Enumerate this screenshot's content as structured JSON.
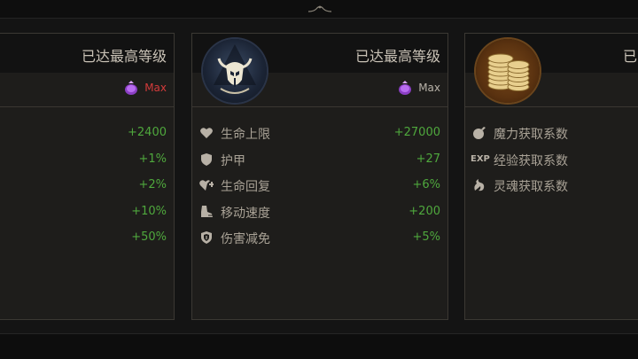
{
  "cards": [
    {
      "title": "已达最高等级",
      "level": "Max",
      "level_color": "#d33b3b",
      "stats": [
        {
          "value": "+2400"
        },
        {
          "value": "+1%"
        },
        {
          "value": "+2%"
        },
        {
          "value": "+10%"
        },
        {
          "value": "+50%"
        }
      ]
    },
    {
      "title": "已达最高等级",
      "level": "Max",
      "level_color": "#b8b2a8",
      "emblem_icon": "horned-helmet-icon",
      "stats": [
        {
          "icon": "heart-icon",
          "label": "生命上限",
          "value": "+27000"
        },
        {
          "icon": "shield-icon",
          "label": "护甲",
          "value": "+27"
        },
        {
          "icon": "heart-regen-icon",
          "label": "生命回复",
          "value": "+6%"
        },
        {
          "icon": "boot-icon",
          "label": "移动速度",
          "value": "+200"
        },
        {
          "icon": "shield-crest-icon",
          "label": "伤害减免",
          "value": "+5%"
        }
      ]
    },
    {
      "title": "已",
      "emblem_icon": "gold-coins-icon",
      "stats": [
        {
          "icon": "mana-orb-icon",
          "label": "魔力获取系数"
        },
        {
          "icon": "exp-icon",
          "icon_text": "EXP",
          "label": "经验获取系数"
        },
        {
          "icon": "soul-icon",
          "label": "灵魂获取系数"
        }
      ]
    }
  ]
}
